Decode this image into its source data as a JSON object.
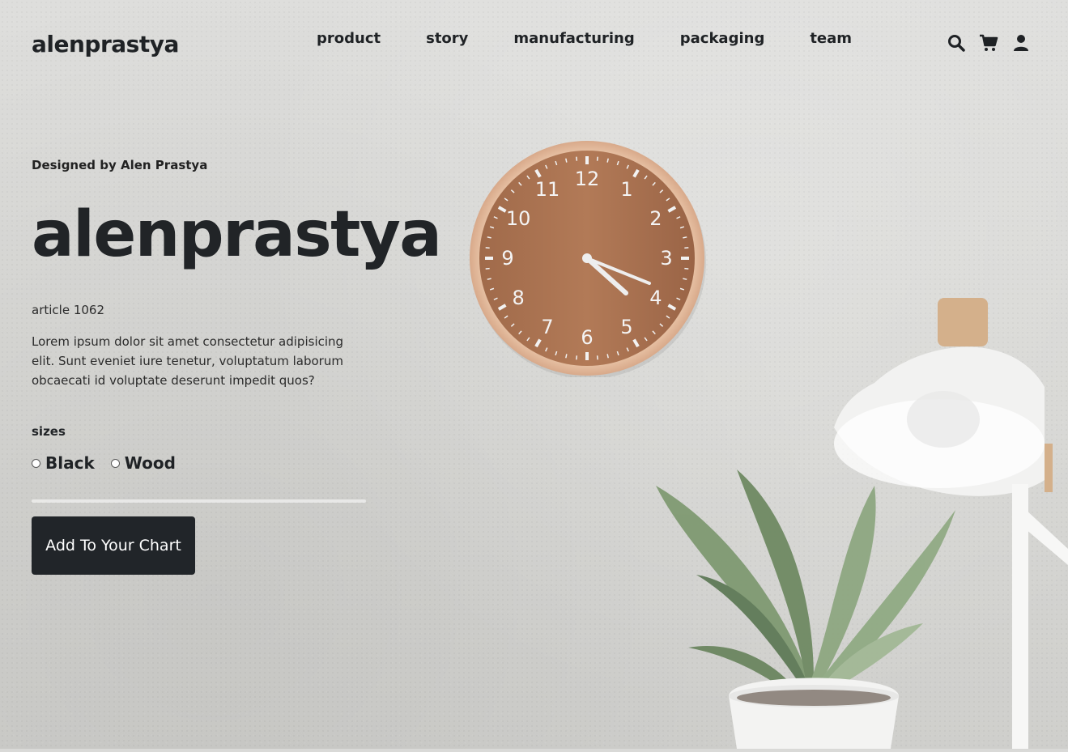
{
  "navbar": {
    "brand": "alenprastya",
    "links": [
      "product",
      "story",
      "manufacturing",
      "packaging",
      "team"
    ],
    "icons": [
      "search-icon",
      "cart-icon",
      "user-icon"
    ]
  },
  "hero": {
    "designed_by": "Designed by Alen Prastya",
    "title": "alenprastya",
    "article": "article 1062",
    "description": "Lorem ipsum dolor sit amet consectetur adipisicing elit. Sunt eveniet iure tenetur, voluptatum laborum obcaecati id voluptate deserunt impedit quos?",
    "sizes_label": "sizes",
    "options": [
      "Black",
      "Wood"
    ],
    "cta_label": "Add To Your Chart"
  },
  "scene": {
    "clock_numbers": [
      "12",
      "1",
      "2",
      "3",
      "4",
      "5",
      "6",
      "7",
      "8",
      "9",
      "10",
      "11"
    ]
  },
  "colors": {
    "wall": "#d9d9d7",
    "text_dark": "#212427",
    "button_bg": "#212529",
    "button_text": "#ffffff",
    "clock_wood": "#a46e4f",
    "clock_rim": "#e7c3a5"
  }
}
